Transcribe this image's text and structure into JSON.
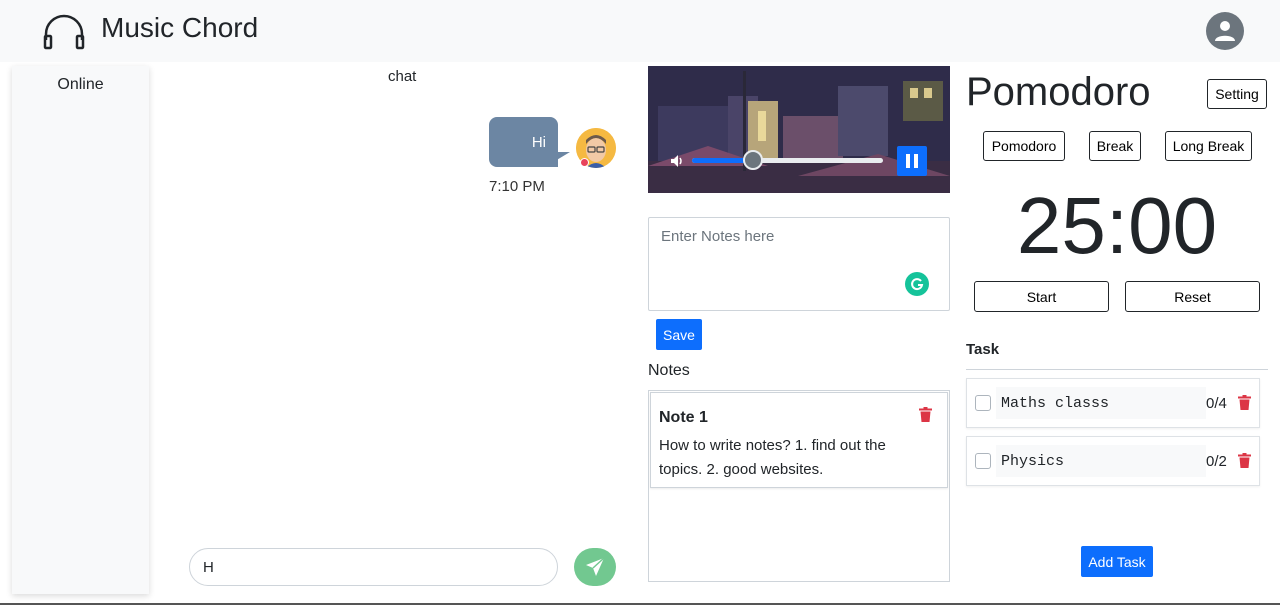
{
  "header": {
    "app_title": "Music Chord",
    "logo_icon": "headphones-icon",
    "profile_icon": "user-icon"
  },
  "sidebar": {
    "title": "Online"
  },
  "chat": {
    "title": "chat",
    "messages": [
      {
        "text": "Hi",
        "time": "7:10 PM"
      }
    ],
    "input_value": "H",
    "send_icon": "paper-plane-icon",
    "bubble_color": "#6c86a3",
    "send_color": "#72c890"
  },
  "player": {
    "mute_icon": "volume-icon",
    "pause_icon": "pause-icon",
    "volume_level": 0.32
  },
  "notes": {
    "input_placeholder": "Enter Notes here",
    "save_label": "Save",
    "heading": "Notes",
    "items": [
      {
        "title": "Note 1",
        "body": "How to write notes? 1. find out the topics. 2. good websites."
      }
    ]
  },
  "pomodoro": {
    "title": "Pomodoro",
    "setting_label": "Setting",
    "modes": [
      "Pomodoro",
      "Break",
      "Long Break"
    ],
    "timer": "25:00",
    "start_label": "Start",
    "reset_label": "Reset",
    "task_heading": "Task",
    "tasks": [
      {
        "name": "Maths classs",
        "count": "0/4"
      },
      {
        "name": "Physics",
        "count": "0/2"
      }
    ],
    "add_task_label": "Add Task",
    "accent_color": "#0d6efd",
    "delete_color": "#dc3545"
  }
}
